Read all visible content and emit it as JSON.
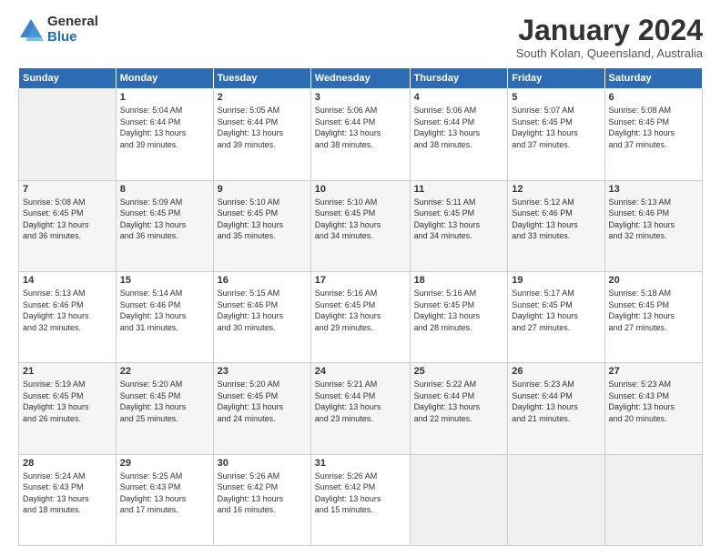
{
  "logo": {
    "general": "General",
    "blue": "Blue"
  },
  "header": {
    "title": "January 2024",
    "subtitle": "South Kolan, Queensland, Australia"
  },
  "days": [
    "Sunday",
    "Monday",
    "Tuesday",
    "Wednesday",
    "Thursday",
    "Friday",
    "Saturday"
  ],
  "weeks": [
    [
      {
        "day": "",
        "content": ""
      },
      {
        "day": "1",
        "content": "Sunrise: 5:04 AM\nSunset: 6:44 PM\nDaylight: 13 hours\nand 39 minutes."
      },
      {
        "day": "2",
        "content": "Sunrise: 5:05 AM\nSunset: 6:44 PM\nDaylight: 13 hours\nand 39 minutes."
      },
      {
        "day": "3",
        "content": "Sunrise: 5:06 AM\nSunset: 6:44 PM\nDaylight: 13 hours\nand 38 minutes."
      },
      {
        "day": "4",
        "content": "Sunrise: 5:06 AM\nSunset: 6:44 PM\nDaylight: 13 hours\nand 38 minutes."
      },
      {
        "day": "5",
        "content": "Sunrise: 5:07 AM\nSunset: 6:45 PM\nDaylight: 13 hours\nand 37 minutes."
      },
      {
        "day": "6",
        "content": "Sunrise: 5:08 AM\nSunset: 6:45 PM\nDaylight: 13 hours\nand 37 minutes."
      }
    ],
    [
      {
        "day": "7",
        "content": "Sunrise: 5:08 AM\nSunset: 6:45 PM\nDaylight: 13 hours\nand 36 minutes."
      },
      {
        "day": "8",
        "content": "Sunrise: 5:09 AM\nSunset: 6:45 PM\nDaylight: 13 hours\nand 36 minutes."
      },
      {
        "day": "9",
        "content": "Sunrise: 5:10 AM\nSunset: 6:45 PM\nDaylight: 13 hours\nand 35 minutes."
      },
      {
        "day": "10",
        "content": "Sunrise: 5:10 AM\nSunset: 6:45 PM\nDaylight: 13 hours\nand 34 minutes."
      },
      {
        "day": "11",
        "content": "Sunrise: 5:11 AM\nSunset: 6:45 PM\nDaylight: 13 hours\nand 34 minutes."
      },
      {
        "day": "12",
        "content": "Sunrise: 5:12 AM\nSunset: 6:46 PM\nDaylight: 13 hours\nand 33 minutes."
      },
      {
        "day": "13",
        "content": "Sunrise: 5:13 AM\nSunset: 6:46 PM\nDaylight: 13 hours\nand 32 minutes."
      }
    ],
    [
      {
        "day": "14",
        "content": "Sunrise: 5:13 AM\nSunset: 6:46 PM\nDaylight: 13 hours\nand 32 minutes."
      },
      {
        "day": "15",
        "content": "Sunrise: 5:14 AM\nSunset: 6:46 PM\nDaylight: 13 hours\nand 31 minutes."
      },
      {
        "day": "16",
        "content": "Sunrise: 5:15 AM\nSunset: 6:46 PM\nDaylight: 13 hours\nand 30 minutes."
      },
      {
        "day": "17",
        "content": "Sunrise: 5:16 AM\nSunset: 6:45 PM\nDaylight: 13 hours\nand 29 minutes."
      },
      {
        "day": "18",
        "content": "Sunrise: 5:16 AM\nSunset: 6:45 PM\nDaylight: 13 hours\nand 28 minutes."
      },
      {
        "day": "19",
        "content": "Sunrise: 5:17 AM\nSunset: 6:45 PM\nDaylight: 13 hours\nand 27 minutes."
      },
      {
        "day": "20",
        "content": "Sunrise: 5:18 AM\nSunset: 6:45 PM\nDaylight: 13 hours\nand 27 minutes."
      }
    ],
    [
      {
        "day": "21",
        "content": "Sunrise: 5:19 AM\nSunset: 6:45 PM\nDaylight: 13 hours\nand 26 minutes."
      },
      {
        "day": "22",
        "content": "Sunrise: 5:20 AM\nSunset: 6:45 PM\nDaylight: 13 hours\nand 25 minutes."
      },
      {
        "day": "23",
        "content": "Sunrise: 5:20 AM\nSunset: 6:45 PM\nDaylight: 13 hours\nand 24 minutes."
      },
      {
        "day": "24",
        "content": "Sunrise: 5:21 AM\nSunset: 6:44 PM\nDaylight: 13 hours\nand 23 minutes."
      },
      {
        "day": "25",
        "content": "Sunrise: 5:22 AM\nSunset: 6:44 PM\nDaylight: 13 hours\nand 22 minutes."
      },
      {
        "day": "26",
        "content": "Sunrise: 5:23 AM\nSunset: 6:44 PM\nDaylight: 13 hours\nand 21 minutes."
      },
      {
        "day": "27",
        "content": "Sunrise: 5:23 AM\nSunset: 6:43 PM\nDaylight: 13 hours\nand 20 minutes."
      }
    ],
    [
      {
        "day": "28",
        "content": "Sunrise: 5:24 AM\nSunset: 6:43 PM\nDaylight: 13 hours\nand 18 minutes."
      },
      {
        "day": "29",
        "content": "Sunrise: 5:25 AM\nSunset: 6:43 PM\nDaylight: 13 hours\nand 17 minutes."
      },
      {
        "day": "30",
        "content": "Sunrise: 5:26 AM\nSunset: 6:42 PM\nDaylight: 13 hours\nand 16 minutes."
      },
      {
        "day": "31",
        "content": "Sunrise: 5:26 AM\nSunset: 6:42 PM\nDaylight: 13 hours\nand 15 minutes."
      },
      {
        "day": "",
        "content": ""
      },
      {
        "day": "",
        "content": ""
      },
      {
        "day": "",
        "content": ""
      }
    ]
  ]
}
